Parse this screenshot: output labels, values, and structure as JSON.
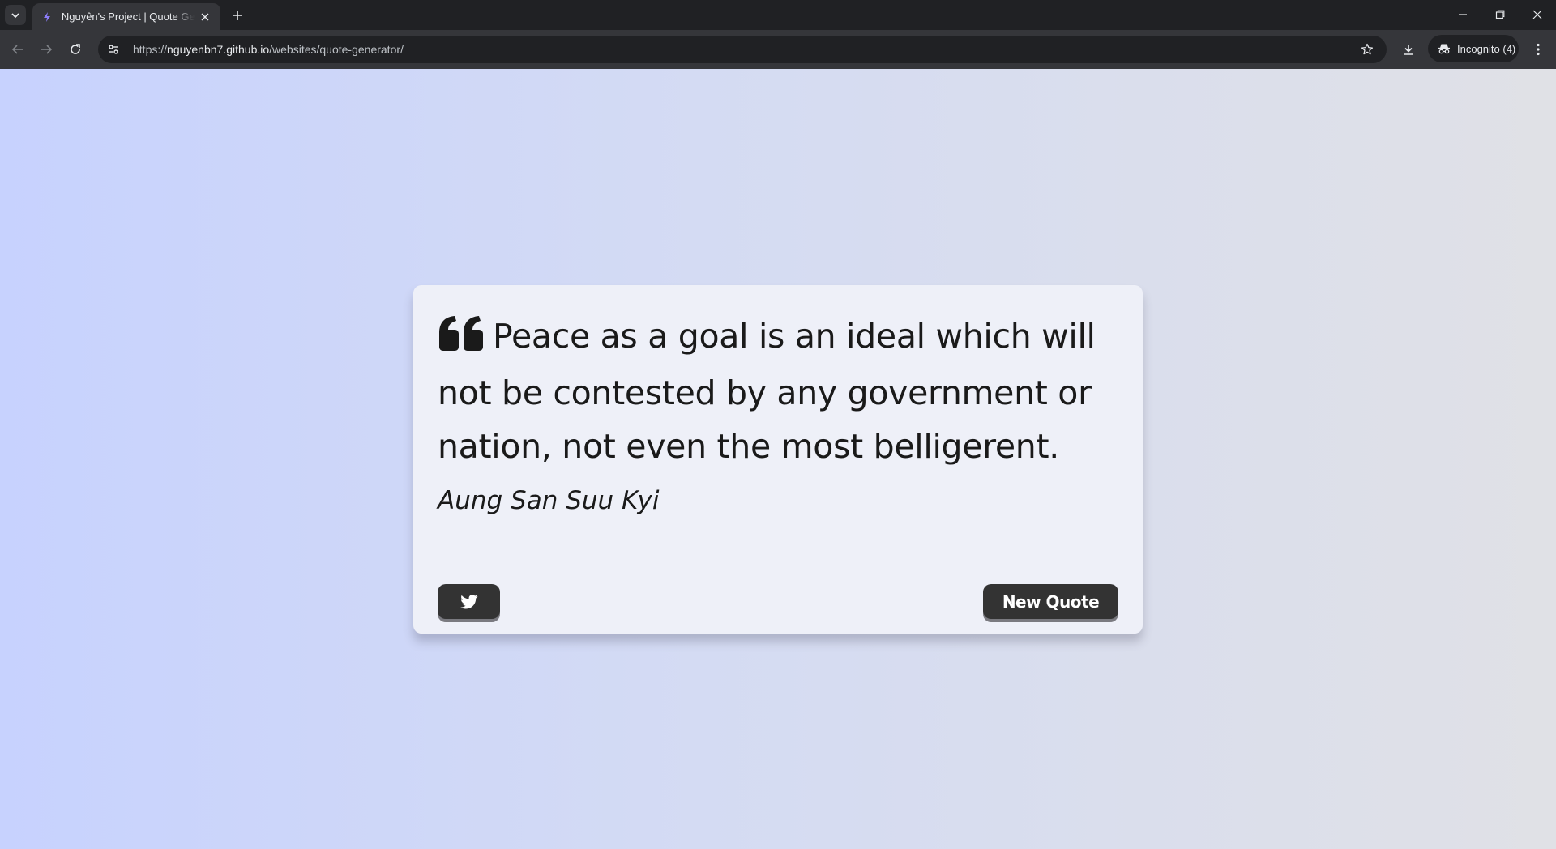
{
  "browser": {
    "tab_title": "Nguyên's Project | Quote Generator",
    "url_prefix": "https://",
    "url_host": "nguyenbn7.github.io",
    "url_path": "/websites/quote-generator/",
    "incognito_label": "Incognito (4)",
    "icons": {
      "tab_menu": "chevron-down-icon",
      "favicon": "lightning-bolt-icon",
      "close_tab": "close-icon",
      "new_tab": "plus-icon",
      "back": "arrow-left-icon",
      "forward": "arrow-right-icon",
      "reload": "reload-icon",
      "site_info": "tune-icon",
      "bookmark": "star-icon",
      "download": "download-icon",
      "incognito": "incognito-icon",
      "menu": "kebab-menu-icon",
      "minimize": "minimize-icon",
      "restore": "restore-icon",
      "close_window": "close-icon"
    }
  },
  "page": {
    "background_gradient": [
      "#c7d2fe",
      "#e0e1e6"
    ],
    "quote": {
      "text": "Peace as a goal is an ideal which will not be contested by any government or nation, not even the most belligerent.",
      "author": "Aung San Suu Kyi",
      "quote_icon": "quote-left-icon"
    },
    "buttons": {
      "twitter_icon": "twitter-icon",
      "new_quote_label": "New Quote",
      "button_color": "#333333"
    }
  }
}
